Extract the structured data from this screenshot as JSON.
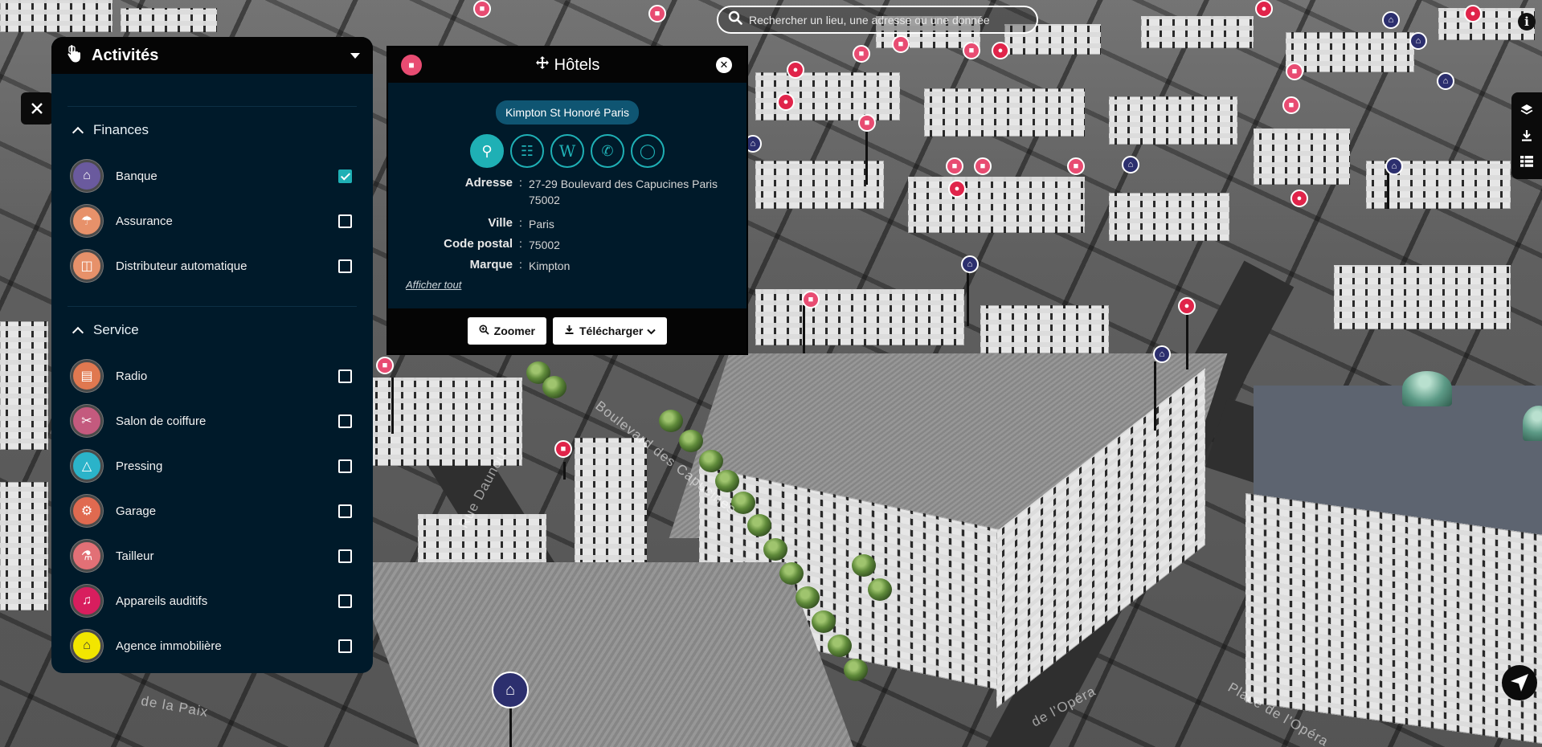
{
  "search": {
    "placeholder": "Rechercher un lieu, une adresse ou une donnée"
  },
  "activities_panel": {
    "title": "Activités",
    "sections": [
      {
        "title": "Finances",
        "items": [
          {
            "label": "Banque",
            "checked": true,
            "color": "#6a5a9e",
            "icon": "bank-icon"
          },
          {
            "label": "Assurance",
            "checked": false,
            "color": "#e7916a",
            "icon": "insurance-icon"
          },
          {
            "label": "Distributeur automatique",
            "checked": false,
            "color": "#e7916a",
            "icon": "atm-icon"
          }
        ]
      },
      {
        "title": "Service",
        "items": [
          {
            "label": "Radio",
            "checked": false,
            "color": "#e07850",
            "icon": "radio-icon"
          },
          {
            "label": "Salon de coiffure",
            "checked": false,
            "color": "#c45a7e",
            "icon": "hair-salon-icon"
          },
          {
            "label": "Pressing",
            "checked": false,
            "color": "#2bb3c9",
            "icon": "pressing-icon"
          },
          {
            "label": "Garage",
            "checked": false,
            "color": "#e06a50",
            "icon": "garage-icon"
          },
          {
            "label": "Tailleur",
            "checked": false,
            "color": "#e27076",
            "icon": "tailor-icon"
          },
          {
            "label": "Appareils auditifs",
            "checked": false,
            "color": "#d81e5e",
            "icon": "hearing-aid-icon"
          },
          {
            "label": "Agence immobilière",
            "checked": false,
            "color": "#f2e600",
            "icon": "real-estate-icon"
          }
        ]
      }
    ]
  },
  "popup": {
    "title": "Hôtels",
    "hotel_name": "Kimpton St Honoré Paris",
    "fields": [
      {
        "key": "Adresse",
        "value": "27-29 Boulevard des Capucines Paris 75002"
      },
      {
        "key": "Ville",
        "value": "Paris"
      },
      {
        "key": "Code postal",
        "value": "75002"
      },
      {
        "key": "Marque",
        "value": "Kimpton"
      }
    ],
    "show_all": "Afficher tout",
    "zoom_label": "Zoomer",
    "download_label": "Télécharger",
    "links": [
      "street-view-icon",
      "barcode-icon",
      "wikipedia-icon",
      "phone-icon",
      "website-icon"
    ]
  },
  "map": {
    "street_labels": [
      "Boulevard des Capucines",
      "Rue Daunou",
      "Place de l'Opéra",
      "de la Paix",
      "de l'Opéra"
    ]
  }
}
